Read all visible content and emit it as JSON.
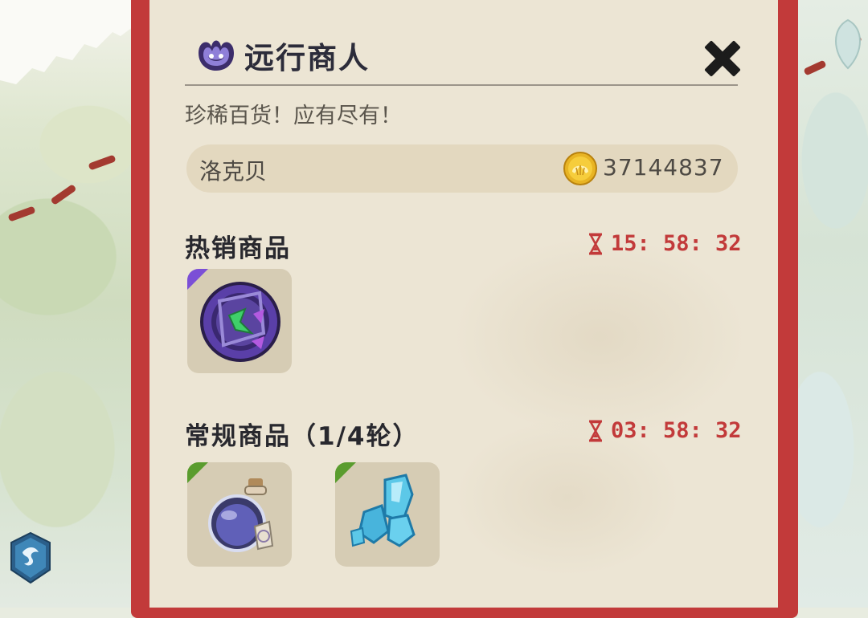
{
  "header": {
    "title": "远行商人",
    "icon": "purple-jester-hat-icon",
    "close_icon": "close-x-icon"
  },
  "subtitle": "珍稀百货！应有尽有！",
  "player": {
    "name": "洛克贝",
    "currency_icon": "gold-shell-coin-icon",
    "currency_amount": "37144837"
  },
  "sections": [
    {
      "title": "热销商品",
      "timer": "15: 58: 32",
      "timer_icon": "hourglass-icon",
      "items": [
        {
          "name": "purple-orb-gem-item",
          "rarity_color": "#7b4fd6"
        }
      ]
    },
    {
      "title": "常规商品（1/4轮）",
      "timer": "03: 58: 32",
      "timer_icon": "hourglass-icon",
      "items": [
        {
          "name": "purple-potion-bottle-item",
          "rarity_color": "#5a9c2e"
        },
        {
          "name": "blue-crystal-cluster-item",
          "rarity_color": "#5a9c2e"
        }
      ]
    }
  ],
  "colors": {
    "panel_border": "#c23a3a",
    "panel_bg": "#ece5d4",
    "timer_text": "#c23a3a"
  }
}
